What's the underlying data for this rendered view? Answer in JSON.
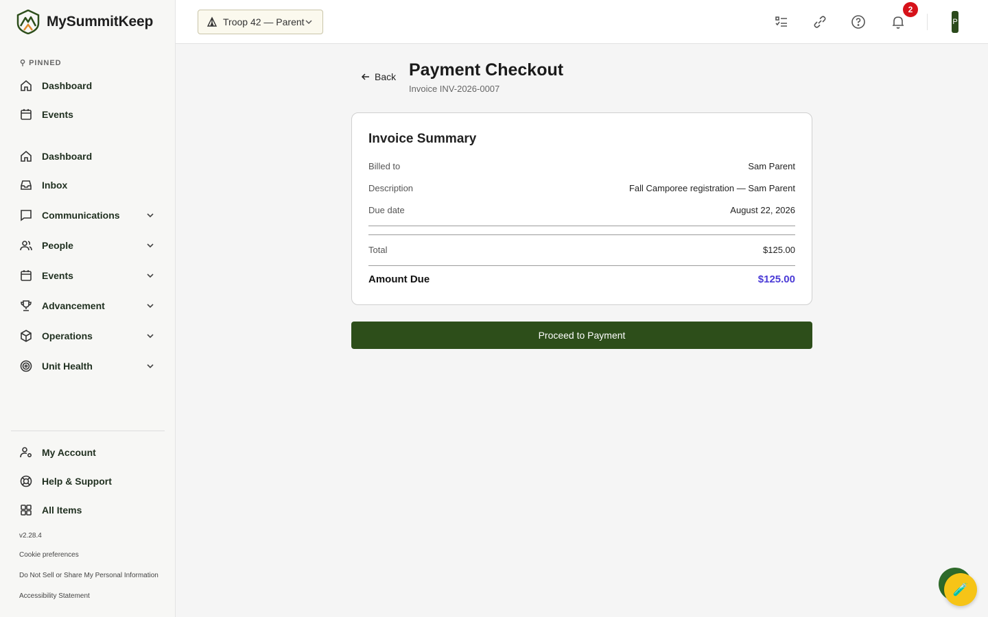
{
  "app": {
    "name": "MySummitKeep"
  },
  "sidebar": {
    "pinned_label": "PINNED",
    "pinned": [
      {
        "label": "Dashboard",
        "icon": "home-icon"
      },
      {
        "label": "Events",
        "icon": "calendar-icon"
      }
    ],
    "items": [
      {
        "label": "Dashboard",
        "icon": "home-icon"
      },
      {
        "label": "Inbox",
        "icon": "inbox-icon"
      },
      {
        "label": "Communications",
        "icon": "chat-icon"
      },
      {
        "label": "People",
        "icon": "people-icon"
      },
      {
        "label": "Events",
        "icon": "calendar-icon"
      },
      {
        "label": "Advancement",
        "icon": "trophy-icon"
      },
      {
        "label": "Operations",
        "icon": "box-icon"
      },
      {
        "label": "Unit Health",
        "icon": "target-icon"
      }
    ],
    "bottom": [
      {
        "label": "My Account",
        "icon": "user-gear-icon"
      },
      {
        "label": "Help & Support",
        "icon": "lifebuoy-icon"
      },
      {
        "label": "All Items",
        "icon": "grid-icon"
      }
    ],
    "version": "v2.28.4",
    "footer_links": [
      "Cookie preferences",
      "Do Not Sell or Share My Personal Information",
      "Accessibility Statement"
    ]
  },
  "topbar": {
    "unit_selector": "Troop 42 — Parent",
    "notification_count": "2",
    "avatar_initial": "P"
  },
  "page": {
    "back_label": "Back",
    "title": "Payment Checkout",
    "subtitle": "Invoice INV-2026-0007"
  },
  "invoice": {
    "title": "Invoice Summary",
    "billed_to_label": "Billed to",
    "billed_to": "Sam Parent",
    "description_label": "Description",
    "description": "Fall Camporee registration — Sam Parent",
    "due_date_label": "Due date",
    "due_date": "August 22, 2026",
    "total_label": "Total",
    "total": "$125.00",
    "amount_due_label": "Amount Due",
    "amount_due": "$125.00"
  },
  "actions": {
    "pay_label": "Proceed to Payment"
  },
  "colors": {
    "brand": "#2d4e1a",
    "amount_due": "#4a3ad6",
    "badge": "#d6121a",
    "fab": "#f6c417"
  }
}
